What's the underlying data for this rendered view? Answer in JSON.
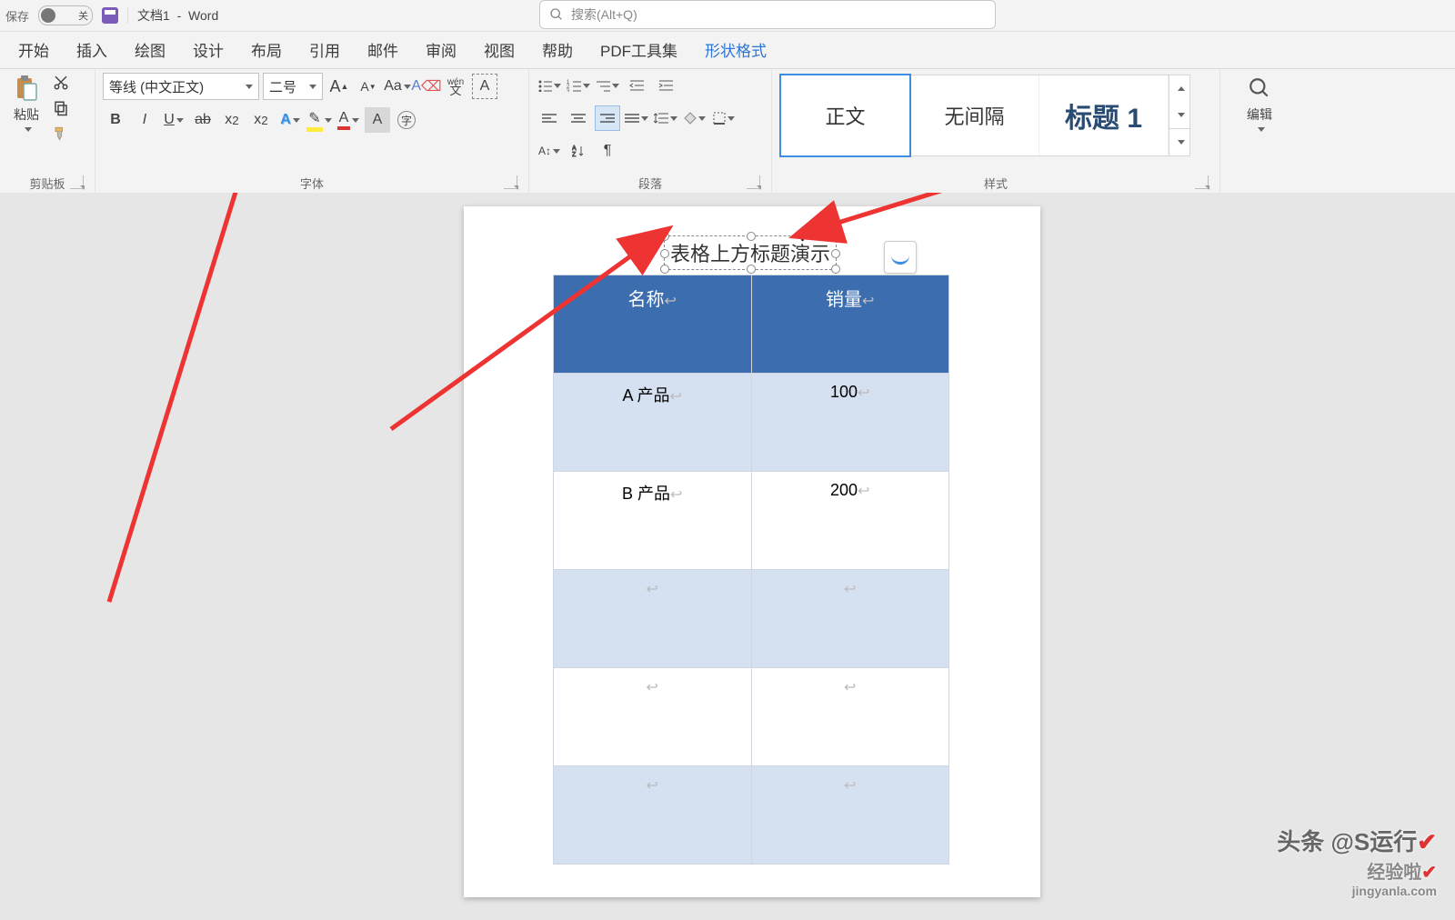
{
  "title": {
    "toggle": "关",
    "doc": "文档1",
    "app": "Word"
  },
  "search": {
    "placeholder": "搜索(Alt+Q)"
  },
  "tabs": [
    "开始",
    "插入",
    "绘图",
    "设计",
    "布局",
    "引用",
    "邮件",
    "审阅",
    "视图",
    "帮助",
    "PDF工具集",
    "形状格式"
  ],
  "clipboard": {
    "label": "剪贴板",
    "paste": "粘贴"
  },
  "font": {
    "label": "字体",
    "family": "等线 (中文正文)",
    "size": "二号"
  },
  "paragraph": {
    "label": "段落"
  },
  "styles": {
    "label": "样式",
    "items": [
      "正文",
      "无间隔",
      "标题 1"
    ]
  },
  "editing": {
    "label": "编辑"
  },
  "document": {
    "textbox": "表格上方标题演示",
    "headers": [
      "名称",
      "销量"
    ],
    "rows": [
      {
        "c1": "A 产品",
        "c2": "100"
      },
      {
        "c1": "B 产品",
        "c2": "200"
      }
    ]
  },
  "watermark": {
    "line1": "头条 @S运行",
    "line2": "经验啦",
    "line3": "jingyanla.com"
  }
}
